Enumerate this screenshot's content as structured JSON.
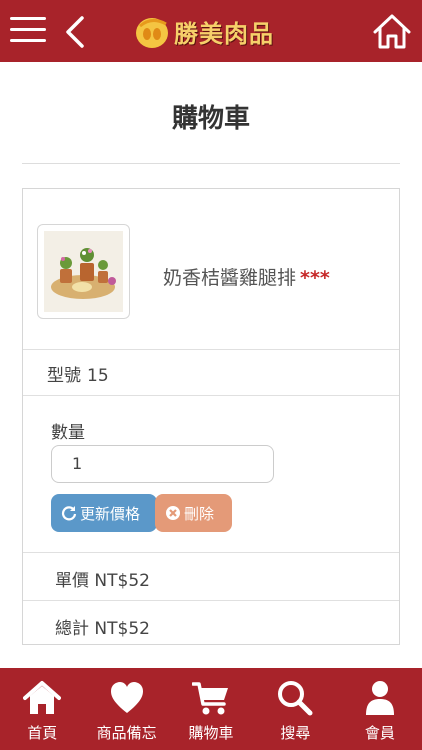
{
  "header": {
    "brand": "勝美肉品",
    "brand_color": "#a8232a"
  },
  "page": {
    "title": "購物車"
  },
  "cart_item": {
    "product_name": "奶香桔醬雞腿排",
    "marker": "***",
    "model_label": "型號",
    "model_value": "15",
    "quantity_label": "數量",
    "quantity_value": "1",
    "update_button": "更新價格",
    "delete_button": "刪除",
    "unit_price_label": "單價",
    "unit_price_value": "NT$52",
    "total_label": "總計",
    "total_value": "NT$52"
  },
  "bottom_nav": [
    {
      "label": "首頁",
      "icon": "home-icon"
    },
    {
      "label": "商品備忘",
      "icon": "heart-icon"
    },
    {
      "label": "購物車",
      "icon": "cart-icon"
    },
    {
      "label": "搜尋",
      "icon": "search-icon"
    },
    {
      "label": "會員",
      "icon": "user-icon"
    }
  ]
}
